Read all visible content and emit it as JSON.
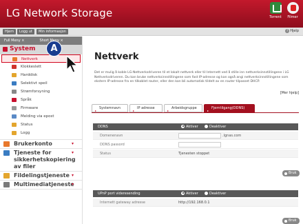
{
  "app": {
    "title": "LG Network Storage"
  },
  "topbar": {
    "icons": [
      {
        "name": "torrent-icon",
        "label": "Torrent"
      },
      {
        "name": "filmer-icon",
        "label": "Filmer"
      }
    ]
  },
  "navbar": {
    "buttons": [
      "Hjem",
      "Logg ut",
      "Min informasjon"
    ],
    "help": "Hjelp"
  },
  "sidebar": {
    "head": [
      "Full Meny ×",
      "Short Meny ×"
    ],
    "system": "System",
    "items": [
      {
        "label": "Nettverk",
        "selected": true,
        "color": "#e8782b"
      },
      {
        "label": "Klokkeslett",
        "color": "#d0342c"
      },
      {
        "label": "Harddisk",
        "color": "#e3a52d"
      },
      {
        "label": "Selektivt speil",
        "color": "#3a7cc2"
      },
      {
        "label": "Strømforsyning",
        "color": "#888888"
      },
      {
        "label": "Språk",
        "color": "#c8102e"
      },
      {
        "label": "Firmware",
        "color": "#999999"
      },
      {
        "label": "Melding via epost",
        "color": "#5a8ac6"
      },
      {
        "label": "Status",
        "color": "#e3a52d"
      },
      {
        "label": "Logg",
        "color": "#e3a52d"
      }
    ],
    "categories": [
      {
        "label": "Brukerkonto",
        "color": "#e8782b"
      },
      {
        "label": "Tjeneste for sikkerhetskopiering av filer",
        "color": "#3a7cc2"
      },
      {
        "label": "Fildelingstjeneste",
        "color": "#e3a52d"
      },
      {
        "label": "Multimediatjeneste",
        "color": "#7a7a7a"
      }
    ]
  },
  "annotation": {
    "badge": "A"
  },
  "main": {
    "title": "Nettverk",
    "intro": "Det er mulig å koble LG-Nettverksdriveren til et lokalt nettverk eller til Internett ved å stille inn nettverksinnstillingene i LG Nettverksdriveren. Du kan bruke nettverksinnstillingene som fast IP-adresse og kan også angi nettverksinnstillingene som ekstern IP-adresse fra en tilkoblet router, eller den kan bli automatisk tildelt av en router tilpasset DHCP.",
    "more": "[Mer hjelp]",
    "tabs": [
      "Systemnavn",
      "IP adresse",
      "Arbeidsgruppe",
      "Fjerntilgang(DDNS)"
    ],
    "ddns": {
      "header": "DDNS",
      "enable": "Aktiver",
      "disable": "Deaktiver",
      "rows": [
        {
          "label": "Domenenavn",
          "suffix": ".lgnas.com"
        },
        {
          "label": "DDNS passord"
        },
        {
          "label": "Status",
          "value": "Tjenesten stoppet"
        }
      ],
      "button": "Bruk"
    },
    "upnp": {
      "header": "UPnP port videresending",
      "enable": "Aktiver",
      "disable": "Deaktiver",
      "row": {
        "label": "Internett gateway adresse",
        "value": "http://192.168.0.1"
      },
      "button": "Bruk"
    }
  }
}
